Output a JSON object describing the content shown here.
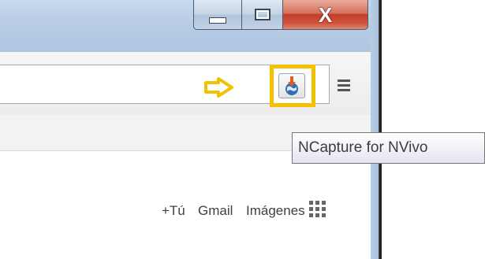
{
  "window": {
    "caption_buttons": {
      "minimize_icon": "minimize-icon",
      "maximize_icon": "maximize-icon",
      "close_label": "X"
    },
    "colors": {
      "close": "#c7462e",
      "frame": "#b9cee5"
    }
  },
  "toolbar": {
    "pointer_icon": "arrow-right-icon",
    "pointer_color": "#f2c100",
    "extension_icon": "ncapture-globe-icon",
    "highlight_color": "#f2c100",
    "menu_icon": "hamburger-menu-icon"
  },
  "tooltip": {
    "text": "NCapture for NVivo"
  },
  "google_bar": {
    "plus_you": "+Tú",
    "gmail": "Gmail",
    "images": "Imágenes",
    "apps_icon": "apps-grid-icon"
  }
}
